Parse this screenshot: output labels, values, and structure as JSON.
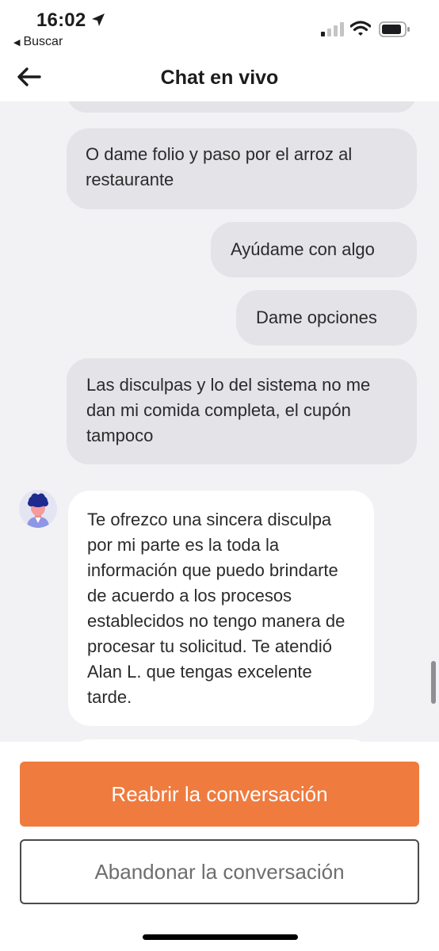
{
  "status_bar": {
    "time": "16:02",
    "back_app_label": "Buscar",
    "icons": [
      "location-arrow-icon",
      "signal-icon",
      "wifi-icon",
      "battery-icon"
    ]
  },
  "nav": {
    "title": "Chat en vivo",
    "back_icon": "arrow-left-icon"
  },
  "messages": [
    {
      "sender": "user",
      "text": ""
    },
    {
      "sender": "user",
      "text": "O dame folio y paso por el arroz al restaurante"
    },
    {
      "sender": "user",
      "text": "Ayúdame con algo"
    },
    {
      "sender": "user",
      "text": "Dame opciones"
    },
    {
      "sender": "user",
      "text": "Las disculpas y lo del sistema no me dan mi comida completa, el cupón tampoco"
    },
    {
      "sender": "agent",
      "text": "Te ofrezco una sincera disculpa por mi parte es la toda la información que puedo brindarte de acuerdo a los procesos establecidos no tengo manera de procesar tu solicitud. Te atendió Alan L. que tengas excelente tarde."
    },
    {
      "sender": "agent",
      "text": ""
    }
  ],
  "actions": {
    "reopen_label": "Reabrir la conversación",
    "abandon_label": "Abandonar la conversación"
  },
  "colors": {
    "accent": "#ef7b3f",
    "chat_background": "#f2f2f5",
    "user_bubble": "#e3e3e8",
    "agent_bubble": "#ffffff"
  }
}
